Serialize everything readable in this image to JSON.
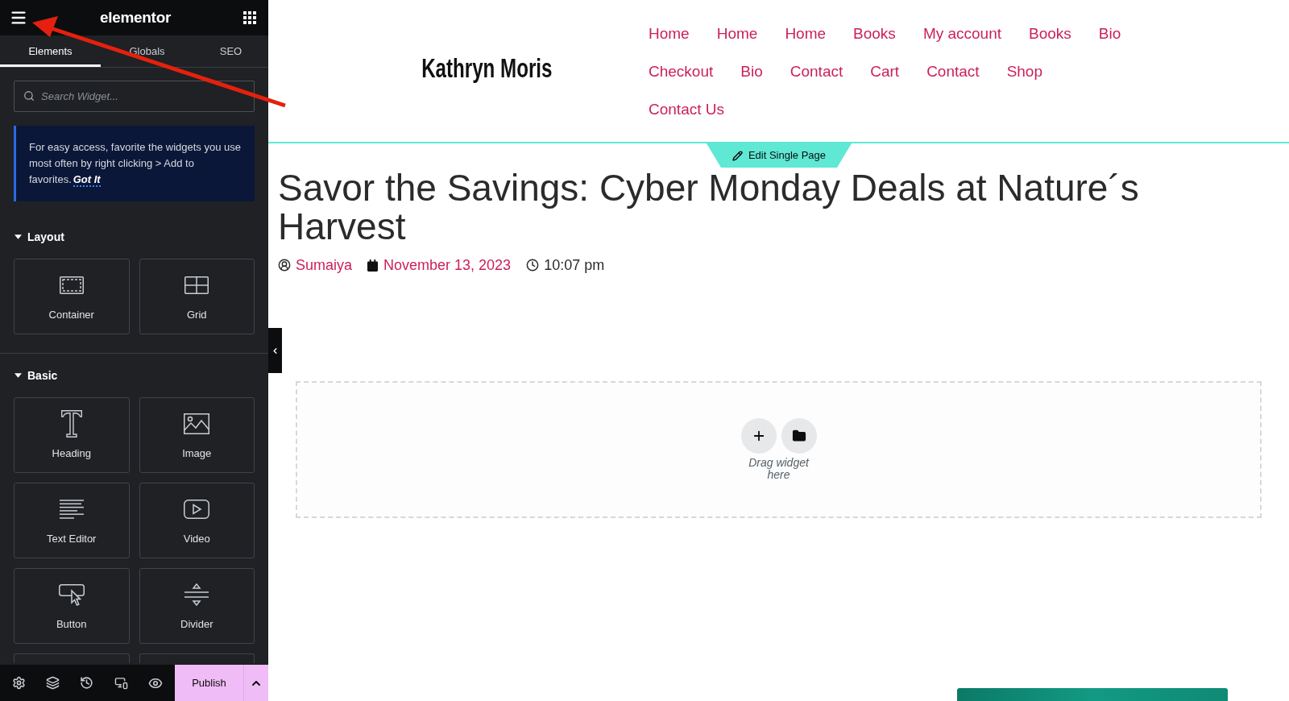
{
  "editor_panel": {
    "logo": "elementor",
    "tabs": [
      {
        "label": "Elements",
        "selected": true
      },
      {
        "label": "Globals",
        "selected": false
      },
      {
        "label": "SEO",
        "selected": false
      }
    ],
    "search": {
      "placeholder": "Search Widget..."
    },
    "notice": {
      "text": "For easy access, favorite the widgets you use most often by right clicking > Add to favorites.",
      "link": "Got It"
    },
    "categories": [
      {
        "title": "Layout",
        "expanded": true,
        "widgets": [
          {
            "label": "Container",
            "kind": "container"
          },
          {
            "label": "Grid",
            "kind": "grid"
          }
        ]
      },
      {
        "title": "Basic",
        "expanded": true,
        "widgets": [
          {
            "label": "Heading",
            "kind": "heading"
          },
          {
            "label": "Image",
            "kind": "image"
          },
          {
            "label": "Text Editor",
            "kind": "text"
          },
          {
            "label": "Video",
            "kind": "video"
          },
          {
            "label": "Button",
            "kind": "button"
          },
          {
            "label": "Divider",
            "kind": "divider"
          }
        ]
      }
    ],
    "footer": {
      "publish": "Publish"
    }
  },
  "page": {
    "site_title": "Kathryn Moris",
    "nav": [
      "Home",
      "Home",
      "Home",
      "Books",
      "My account",
      "Books",
      "Bio",
      "Checkout",
      "Bio",
      "Contact",
      "Cart",
      "Contact",
      "Shop",
      "Contact Us"
    ],
    "edit_button": "Edit Single Page",
    "post": {
      "title": "Savor the Savings: Cyber Monday Deals at Nature´s Harvest",
      "author": "Sumaiya",
      "date": "November 13, 2023",
      "time": "10:07 pm"
    },
    "drop_zone": {
      "hint": "Drag widget here"
    }
  }
}
